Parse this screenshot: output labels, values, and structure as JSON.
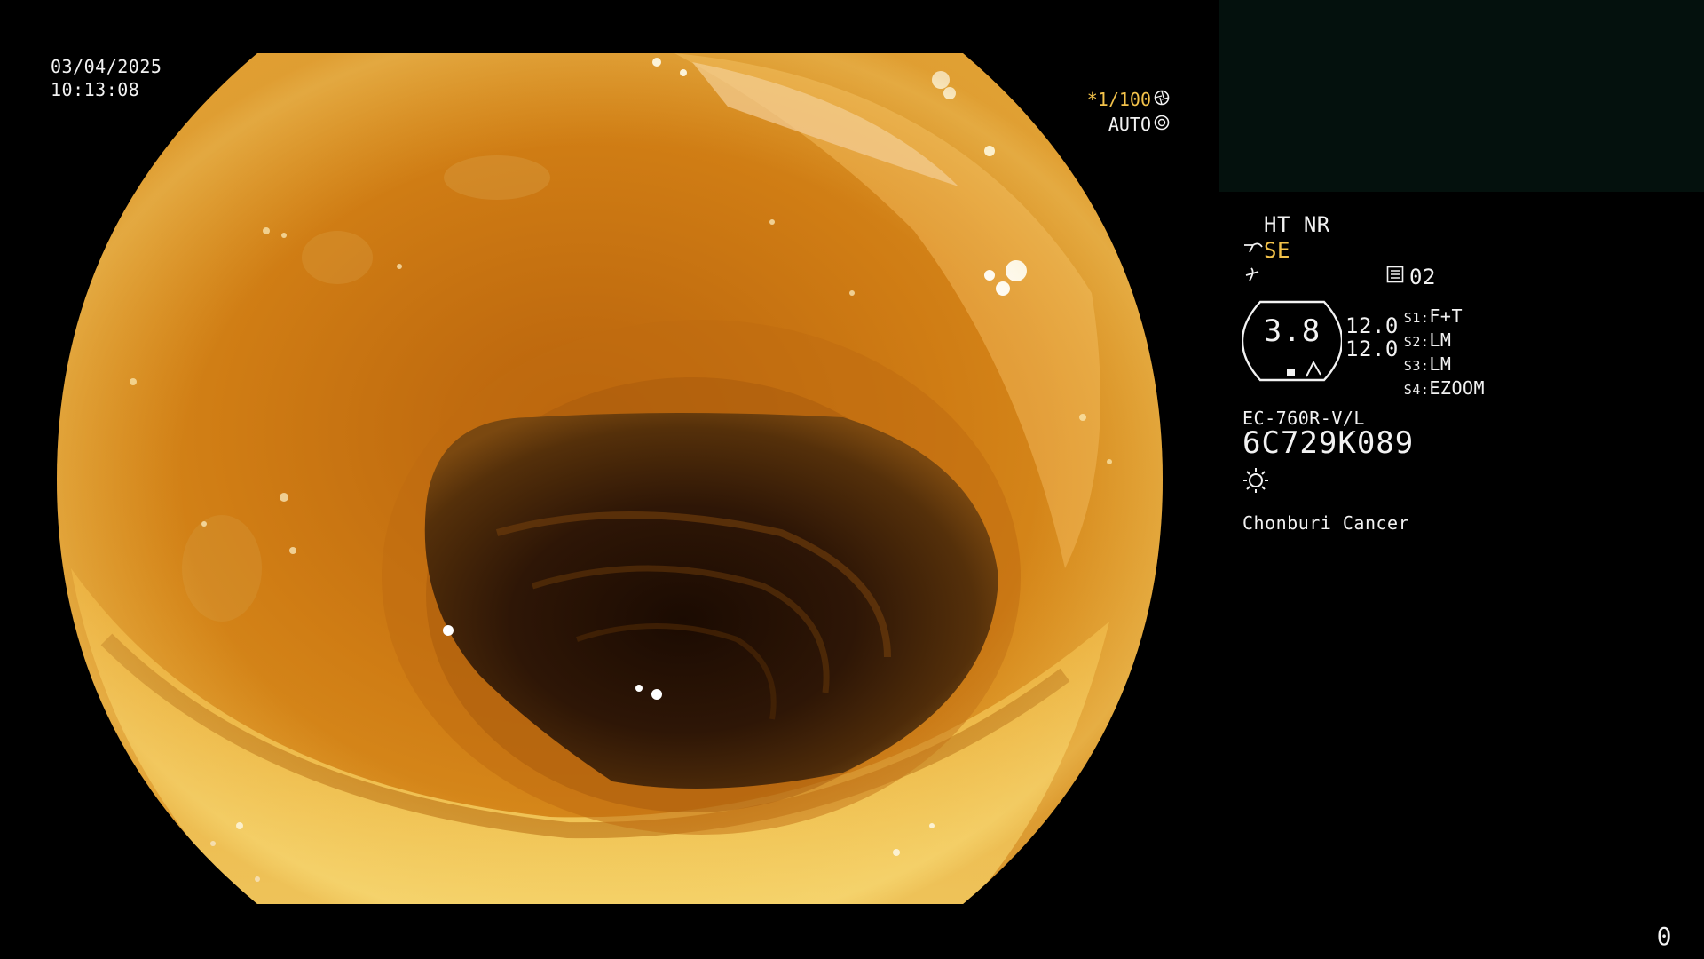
{
  "overlay": {
    "date": "03/04/2025",
    "time": "10:13:08",
    "shutter_speed": "*1/100",
    "iris_mode": "AUTO",
    "counter": "0"
  },
  "info_panel": {
    "mode_line": "HT NR",
    "structure_mode": "SE",
    "memory_slot": "02",
    "zoom_value": "3.8",
    "scale_top": "12.0",
    "scale_bottom": "12.0",
    "switches": [
      {
        "key": "S1:",
        "value": "F+T"
      },
      {
        "key": "S2:",
        "value": "LM"
      },
      {
        "key": "S3:",
        "value": "LM"
      },
      {
        "key": "S4:",
        "value": "EZOOM"
      }
    ],
    "scope_model": "EC-760R-V/L",
    "serial_number": "6C729K089",
    "institution": "Chonburi Cancer"
  },
  "colors": {
    "tissue_base": "#c8770f",
    "tissue_highlight": "#f5d36a",
    "lumen_dark": "#2a1404",
    "osd_text": "#f2f2f2",
    "osd_accent": "#f3c24a",
    "thumbnail_bg": "#04110d"
  }
}
